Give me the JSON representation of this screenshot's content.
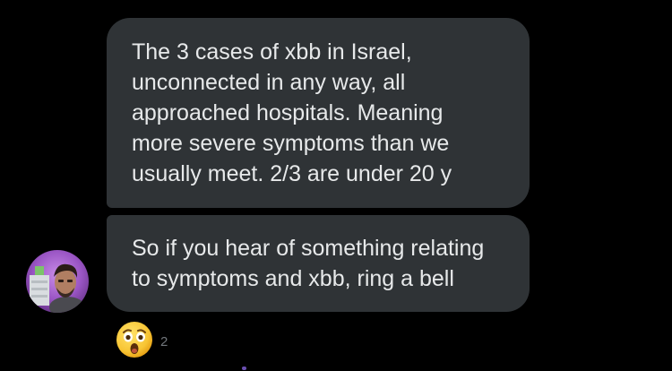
{
  "conversation": {
    "messages": [
      {
        "lines": [
          "The 3 cases of xbb in Israel,",
          "unconnected in any way, all",
          "approached hospitals. Meaning",
          "more severe symptoms than we",
          "usually meet. 2/3 are under 20 y"
        ]
      },
      {
        "lines": [
          "So if you hear of something relating",
          "to symptoms and xbb, ring a bell"
        ]
      }
    ],
    "reaction": {
      "icon": "astonished-face-icon",
      "count": "2"
    }
  },
  "colors": {
    "background": "#000000",
    "bubble": "#2f3336",
    "text": "#e7e9ea",
    "muted": "#71767b"
  }
}
